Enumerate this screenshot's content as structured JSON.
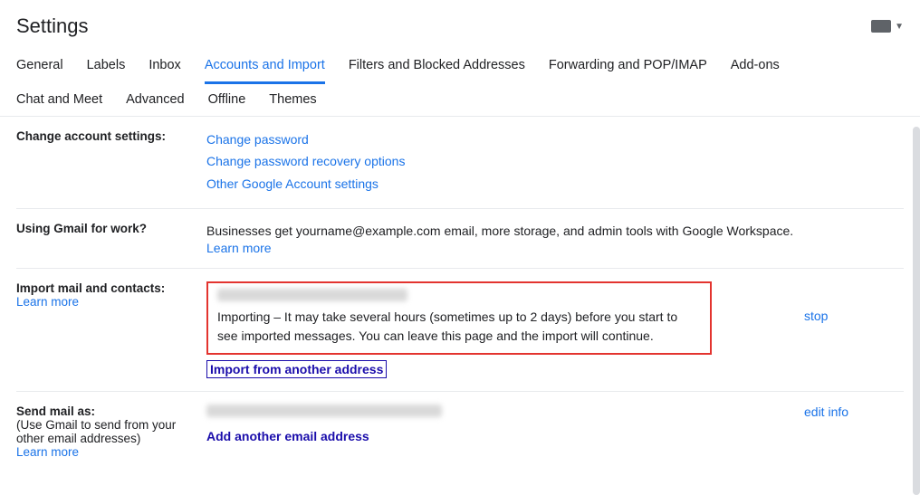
{
  "header": {
    "title": "Settings"
  },
  "tabs": {
    "row1": [
      {
        "label": "General"
      },
      {
        "label": "Labels"
      },
      {
        "label": "Inbox"
      },
      {
        "label": "Accounts and Import",
        "active": true
      },
      {
        "label": "Filters and Blocked Addresses"
      },
      {
        "label": "Forwarding and POP/IMAP"
      },
      {
        "label": "Add-ons"
      }
    ],
    "row2": [
      {
        "label": "Chat and Meet"
      },
      {
        "label": "Advanced"
      },
      {
        "label": "Offline"
      },
      {
        "label": "Themes"
      }
    ]
  },
  "sections": {
    "change_account": {
      "label": "Change account settings:",
      "links": [
        "Change password",
        "Change password recovery options",
        "Other Google Account settings"
      ]
    },
    "workspace": {
      "label": "Using Gmail for work?",
      "text": "Businesses get yourname@example.com email, more storage, and admin tools with Google Workspace.",
      "learn": "Learn more"
    },
    "import": {
      "label": "Import mail and contacts:",
      "learn": "Learn more",
      "status": "Importing – It may take several hours (sometimes up to 2 days) before you start to see imported messages. You can leave this page and the import will continue.",
      "import_another": "Import from another address",
      "stop": "stop"
    },
    "send_as": {
      "label": "Send mail as:",
      "sub": "(Use Gmail to send from your other email addresses)",
      "learn": "Learn more",
      "add": "Add another email address",
      "edit": "edit info"
    }
  }
}
